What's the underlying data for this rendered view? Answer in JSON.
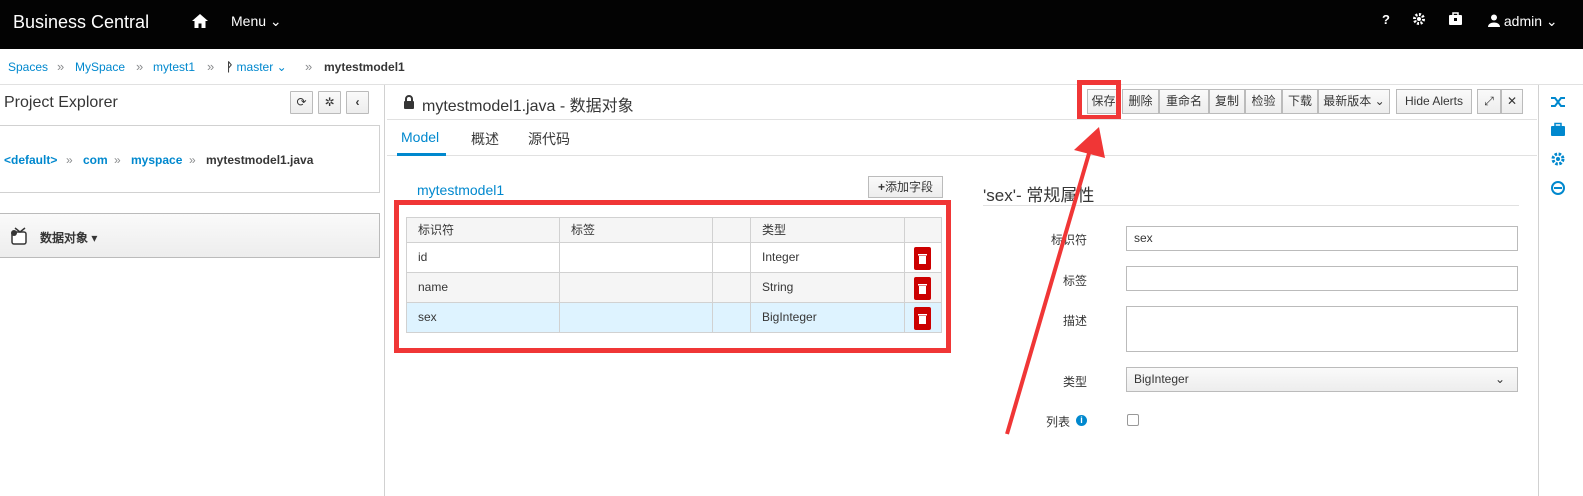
{
  "topbar": {
    "brand": "Business Central",
    "menu_label": "Menu",
    "help_label": "?",
    "user_label": "admin"
  },
  "breadcrumb": {
    "items": [
      "Spaces",
      "MySpace",
      "mytest1",
      "master"
    ],
    "separator": "»",
    "current": "mytestmodel1"
  },
  "project_explorer": {
    "title": "Project Explorer",
    "path": [
      "<default>",
      "com",
      "myspace",
      "mytestmodel1.java"
    ],
    "dropdown_label": "数据对象"
  },
  "editor": {
    "title": "mytestmodel1.java - 数据对象",
    "toolbar": {
      "save": "保存",
      "delete": "删除",
      "rename": "重命名",
      "copy": "复制",
      "validate": "检验",
      "download": "下载",
      "latest": "最新版本",
      "hide_alerts": "Hide Alerts"
    },
    "tabs": [
      "Model",
      "概述",
      "源代码"
    ],
    "active_tab": "Model"
  },
  "model": {
    "object_name": "mytestmodel1",
    "add_field": "添加字段",
    "columns": [
      "标识符",
      "标签",
      "",
      "类型",
      ""
    ],
    "rows": [
      {
        "id": "id",
        "label": "",
        "type": "Integer"
      },
      {
        "id": "name",
        "label": "",
        "type": "String"
      },
      {
        "id": "sex",
        "label": "",
        "type": "BigInteger"
      }
    ]
  },
  "properties": {
    "title": "'sex'- 常规属性",
    "identifier_label": "标识符",
    "identifier_value": "sex",
    "label_label": "标签",
    "label_value": "",
    "description_label": "描述",
    "type_label": "类型",
    "type_value": "BigInteger",
    "list_label": "列表"
  },
  "colors": {
    "accent": "#0088ce",
    "highlight": "#f03636",
    "delete": "#cc0000"
  }
}
